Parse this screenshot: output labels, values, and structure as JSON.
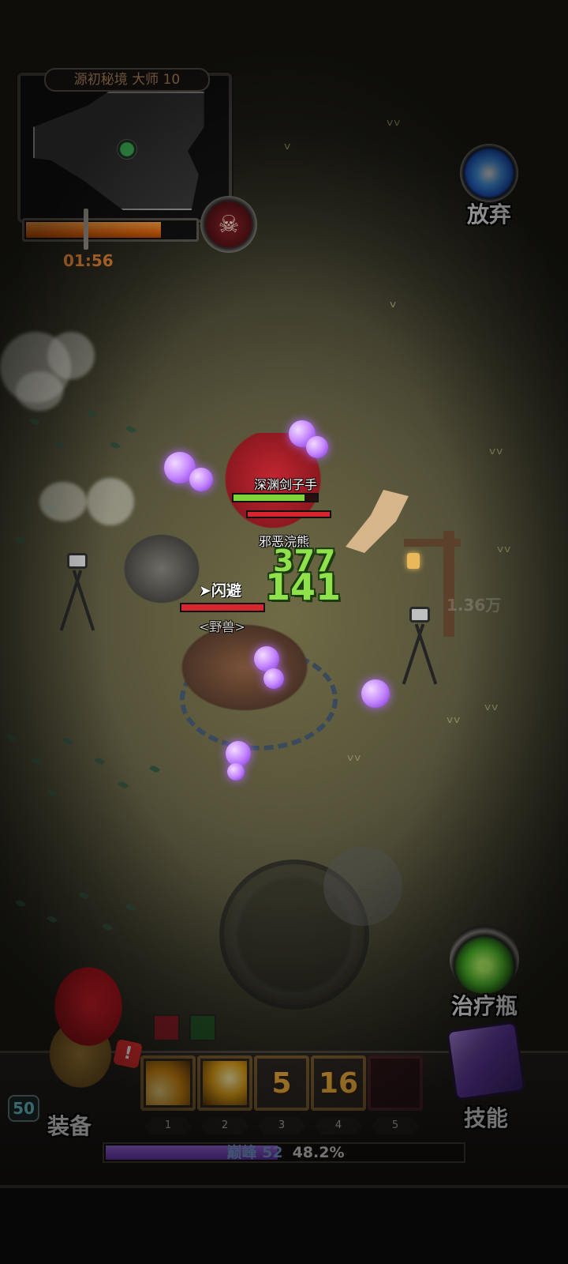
{
  "minimap": {
    "dungeon_title": "源初秘境 大师 10",
    "timer": "01:56",
    "progress_fraction": 0.8
  },
  "top_right": {
    "abandon_label": "放弃"
  },
  "battle": {
    "enemy_1_name": "深渊剑子手",
    "enemy_1_hp_fraction": 0.85,
    "enemy_2_name": "邪恶浣熊",
    "enemy_3_name": "<野兽>",
    "enemy_3_hp_fraction": 1.0,
    "damage_1": "377",
    "damage_2": "141",
    "dodge_text": "闪避",
    "faded_value": "1.36万"
  },
  "right_controls": {
    "potion_label": "治疗瓶"
  },
  "hero": {
    "level": "50",
    "equip_label": "装备",
    "alert": "!"
  },
  "skill_bar": {
    "slots": [
      {
        "number": "1",
        "cooldown": ""
      },
      {
        "number": "2",
        "cooldown": ""
      },
      {
        "number": "3",
        "cooldown": "5"
      },
      {
        "number": "4",
        "cooldown": "16"
      },
      {
        "number": "5",
        "cooldown": ""
      }
    ],
    "skills_label": "技能"
  },
  "xp": {
    "rank": "巅峰 52",
    "percent": "48.2%",
    "fraction": 0.482
  },
  "colors": {
    "accent_orange": "#f08b3a",
    "hp_green": "#7fd63a",
    "hp_red": "#d8262f",
    "damage_green": "#8fe24c",
    "xp_purple": "#8a4fe0"
  }
}
